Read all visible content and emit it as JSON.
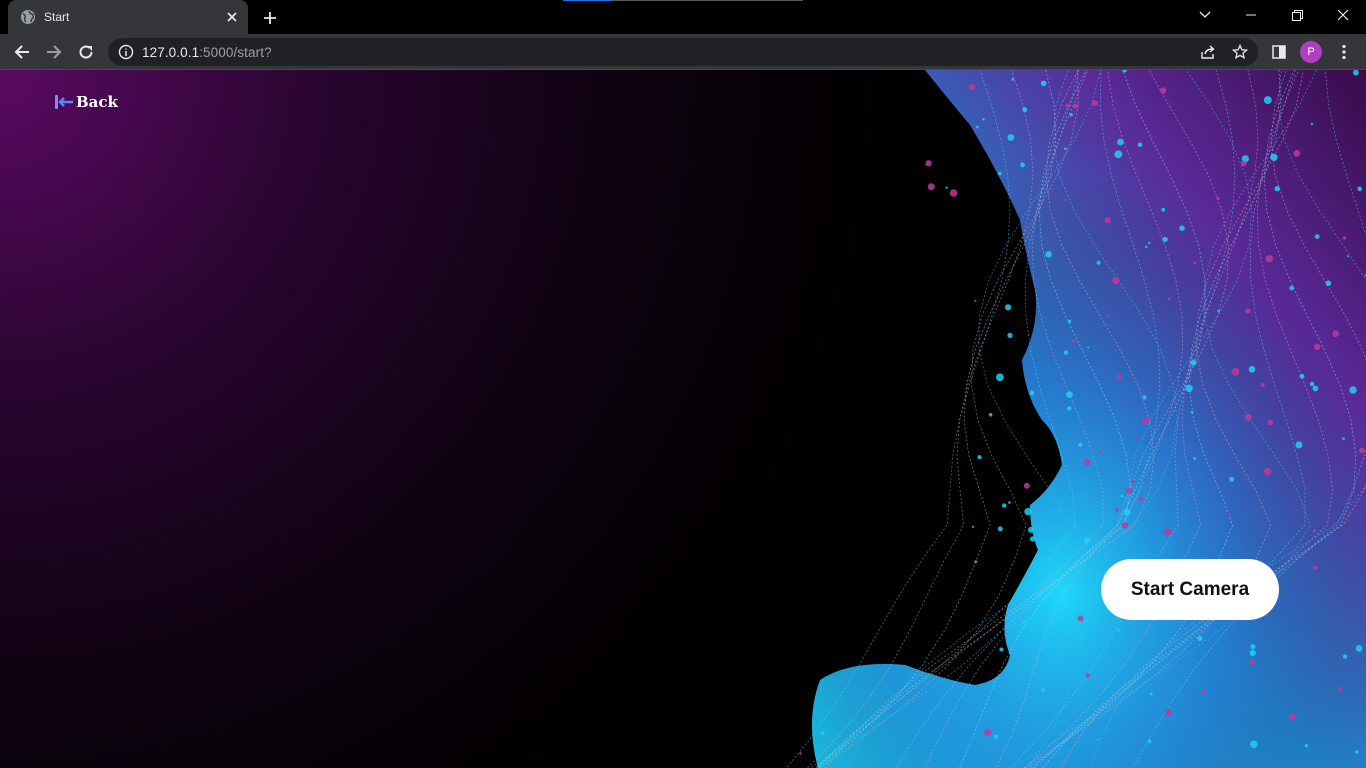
{
  "browser": {
    "tab": {
      "title": "Start",
      "close_label": "✕"
    },
    "new_tab_label": "+",
    "address": {
      "host": "127.0.0.1",
      "path": ":5000/start?"
    },
    "profile_initial": "P"
  },
  "page": {
    "back_label": "Back",
    "start_camera_label": "Start Camera"
  },
  "colors": {
    "accent_button": "#ffffff",
    "background_glow": "#5a0a63",
    "wave_cyan": "#18c8ea",
    "wave_magenta": "#a0308a"
  },
  "icons": [
    "globe-icon",
    "close-icon",
    "plus-icon",
    "back-arrow-icon",
    "forward-arrow-icon",
    "reload-icon",
    "info-icon",
    "share-icon",
    "star-icon",
    "side-panel-icon",
    "menu-icon",
    "back-link-icon"
  ]
}
